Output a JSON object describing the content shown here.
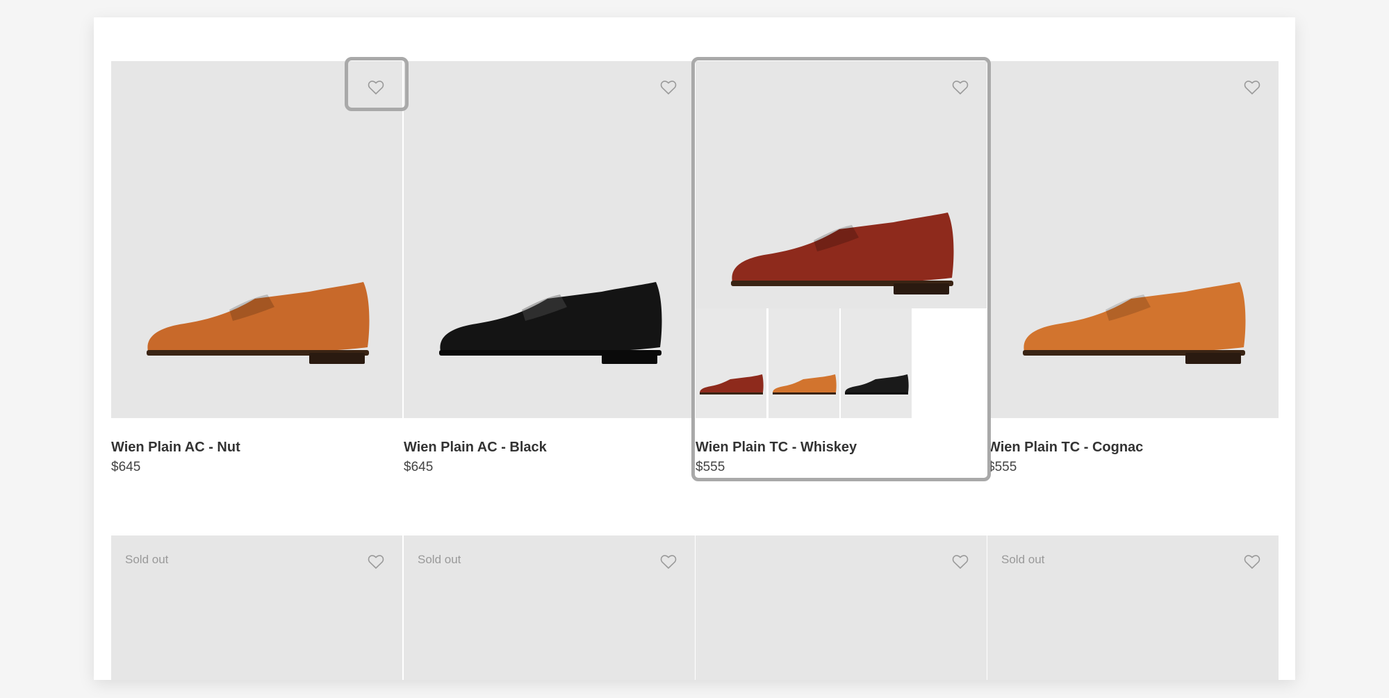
{
  "products": [
    {
      "name": "Wien Plain AC - Nut",
      "price": "$645",
      "color": "#c8692a",
      "woven": true
    },
    {
      "name": "Wien Plain AC - Black",
      "price": "$645",
      "color": "#141414",
      "woven": true
    },
    {
      "name": "Wien Plain TC - Whiskey",
      "price": "$555",
      "color": "#8e2a1c",
      "woven": false
    },
    {
      "name": "Wien Plain TC - Cognac",
      "price": "$555",
      "color": "#d2742e",
      "woven": false
    }
  ],
  "swatches": [
    {
      "color": "#8e2a1c"
    },
    {
      "color": "#d2742e"
    },
    {
      "color": "#1a1a1a"
    }
  ],
  "second_row": [
    {
      "badge": "Sold out"
    },
    {
      "badge": "Sold out"
    },
    {
      "badge": ""
    },
    {
      "badge": "Sold out"
    }
  ],
  "icons": {
    "wishlist": "heart-outline-icon"
  },
  "colors": {
    "image_bg": "#e6e6e6",
    "focus_ring": "#a9a9a9"
  }
}
